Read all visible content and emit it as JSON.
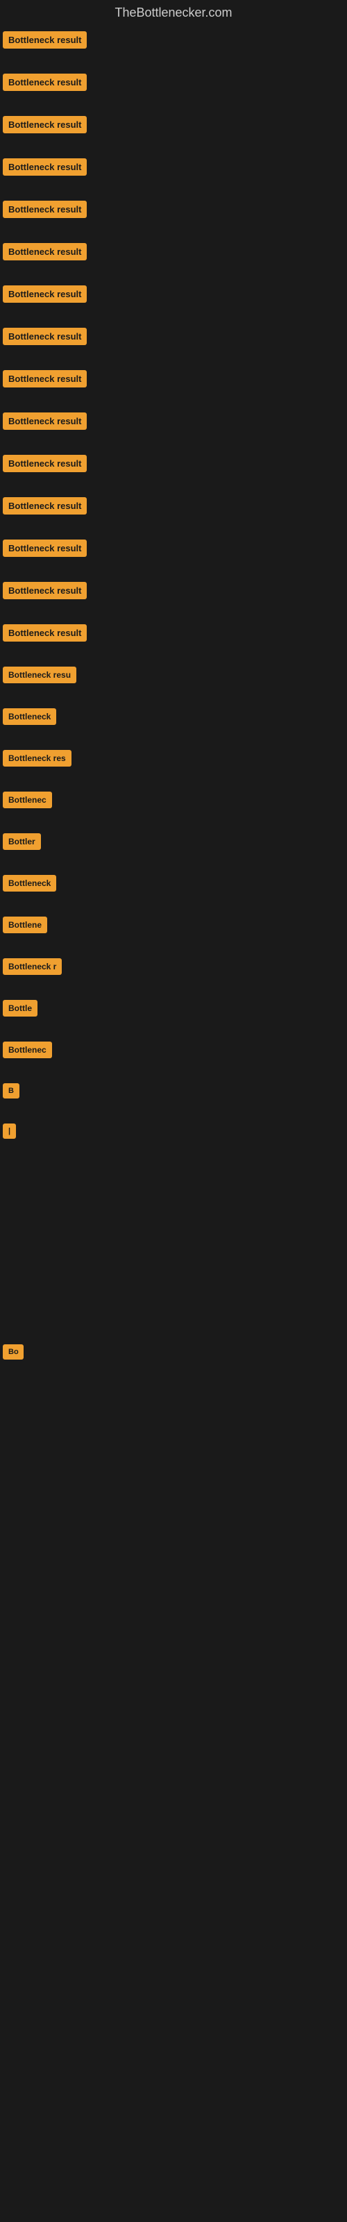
{
  "site": {
    "title": "TheBottlenecker.com"
  },
  "colors": {
    "background": "#1a1a1a",
    "badge_bg": "#f0a030",
    "badge_text": "#1a1a1a",
    "title_text": "#cccccc"
  },
  "rows": [
    {
      "id": 1,
      "label": "Bottleneck result",
      "class": "row-1"
    },
    {
      "id": 2,
      "label": "Bottleneck result",
      "class": "row-2"
    },
    {
      "id": 3,
      "label": "Bottleneck result",
      "class": "row-3"
    },
    {
      "id": 4,
      "label": "Bottleneck result",
      "class": "row-4"
    },
    {
      "id": 5,
      "label": "Bottleneck result",
      "class": "row-5"
    },
    {
      "id": 6,
      "label": "Bottleneck result",
      "class": "row-6"
    },
    {
      "id": 7,
      "label": "Bottleneck result",
      "class": "row-7"
    },
    {
      "id": 8,
      "label": "Bottleneck result",
      "class": "row-8"
    },
    {
      "id": 9,
      "label": "Bottleneck result",
      "class": "row-9"
    },
    {
      "id": 10,
      "label": "Bottleneck result",
      "class": "row-10"
    },
    {
      "id": 11,
      "label": "Bottleneck result",
      "class": "row-11"
    },
    {
      "id": 12,
      "label": "Bottleneck result",
      "class": "row-12"
    },
    {
      "id": 13,
      "label": "Bottleneck result",
      "class": "row-13"
    },
    {
      "id": 14,
      "label": "Bottleneck result",
      "class": "row-14"
    },
    {
      "id": 15,
      "label": "Bottleneck result",
      "class": "row-15"
    },
    {
      "id": 16,
      "label": "Bottleneck resu",
      "class": "row-16"
    },
    {
      "id": 17,
      "label": "Bottleneck",
      "class": "row-17"
    },
    {
      "id": 18,
      "label": "Bottleneck res",
      "class": "row-18"
    },
    {
      "id": 19,
      "label": "Bottlenec",
      "class": "row-19"
    },
    {
      "id": 20,
      "label": "Bottler",
      "class": "row-20"
    },
    {
      "id": 21,
      "label": "Bottleneck",
      "class": "row-21"
    },
    {
      "id": 22,
      "label": "Bottlene",
      "class": "row-22"
    },
    {
      "id": 23,
      "label": "Bottleneck r",
      "class": "row-23"
    },
    {
      "id": 24,
      "label": "Bottle",
      "class": "row-24"
    },
    {
      "id": 25,
      "label": "Bottlenec",
      "class": "row-25"
    },
    {
      "id": 26,
      "label": "B",
      "class": "row-26"
    },
    {
      "id": 27,
      "label": "|",
      "class": "row-27"
    },
    {
      "id": 28,
      "label": "",
      "class": "row-28"
    },
    {
      "id": 29,
      "label": "",
      "class": "row-29"
    },
    {
      "id": 30,
      "label": "",
      "class": "row-30"
    },
    {
      "id": 31,
      "label": "Bo",
      "class": "row-31"
    },
    {
      "id": 32,
      "label": "",
      "class": "row-32"
    },
    {
      "id": 33,
      "label": "",
      "class": "row-33"
    },
    {
      "id": 34,
      "label": "",
      "class": "row-34"
    }
  ]
}
